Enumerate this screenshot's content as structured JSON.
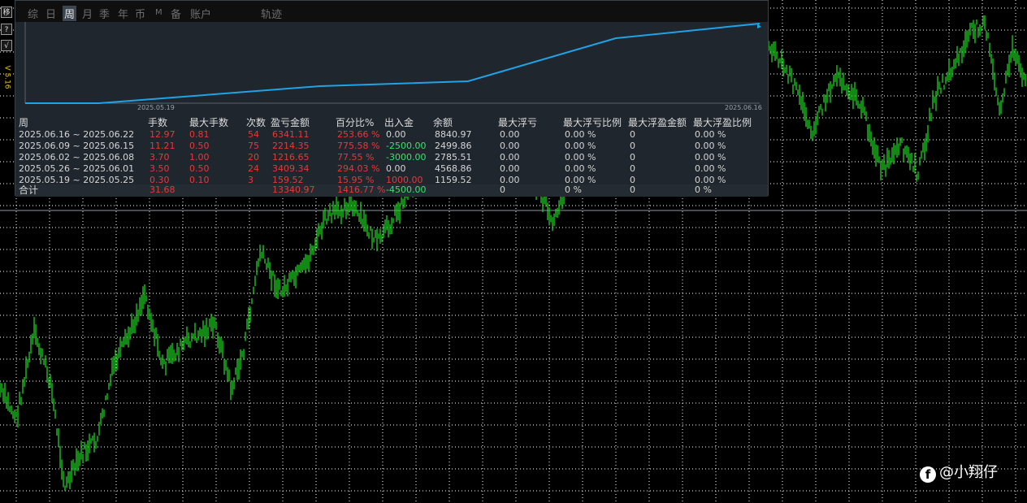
{
  "side_buttons": [
    "移",
    "?",
    "√"
  ],
  "version": "V 5.16",
  "tabs": [
    "综",
    "日",
    "周",
    "月",
    "季",
    "年",
    "币",
    "M",
    "备",
    "账户",
    "轨迹"
  ],
  "active_tab": "周",
  "equity_chart": {
    "start_label": "2025.05.19",
    "end_label": "2025.06.16",
    "line_color": "#1fa3e6"
  },
  "table": {
    "headers": [
      "周",
      "手数",
      "最大手数",
      "次数",
      "盈亏金额",
      "百分比%",
      "出入金",
      "余额",
      "最大浮亏",
      "最大浮亏比例",
      "最大浮盈金额",
      "最大浮盈比例"
    ],
    "rows": [
      [
        "2025.06.16 ~ 2025.06.22",
        "12.97",
        "0.81",
        "54",
        "6341.11",
        "253.66 %",
        "0.00",
        "8840.97",
        "0.00",
        "0.00 %",
        "0",
        "0.00 %"
      ],
      [
        "2025.06.09 ~ 2025.06.15",
        "11.21",
        "0.50",
        "75",
        "2214.35",
        "775.58 %",
        "-2500.00",
        "2499.86",
        "0.00",
        "0.00 %",
        "0",
        "0.00 %"
      ],
      [
        "2025.06.02 ~ 2025.06.08",
        "3.70",
        "1.00",
        "20",
        "1216.65",
        "77.55 %",
        "-3000.00",
        "2785.51",
        "0.00",
        "0.00 %",
        "0",
        "0.00 %"
      ],
      [
        "2025.05.26 ~ 2025.06.01",
        "3.50",
        "0.50",
        "24",
        "3409.34",
        "294.03 %",
        "0.00",
        "4568.86",
        "0.00",
        "0.00 %",
        "0",
        "0.00 %"
      ],
      [
        "2025.05.19 ~ 2025.05.25",
        "0.30",
        "0.10",
        "3",
        "159.52",
        "15.95 %",
        "1000.00",
        "1159.52",
        "0.00",
        "0.00 %",
        "0",
        "0.00 %"
      ]
    ],
    "total": [
      "合计",
      "31.68",
      "",
      "",
      "13340.97",
      "1416.77 %",
      "-4500.00",
      "",
      "0",
      "0 %",
      "0",
      "0 %"
    ]
  },
  "watermark": {
    "icon": "facebook-icon",
    "text": "@小翔仔"
  },
  "colors": {
    "candles": "#1fd21f",
    "grid": "#ffffff",
    "profit": "#e23b3b",
    "inflow_negative": "#3ee06a"
  }
}
